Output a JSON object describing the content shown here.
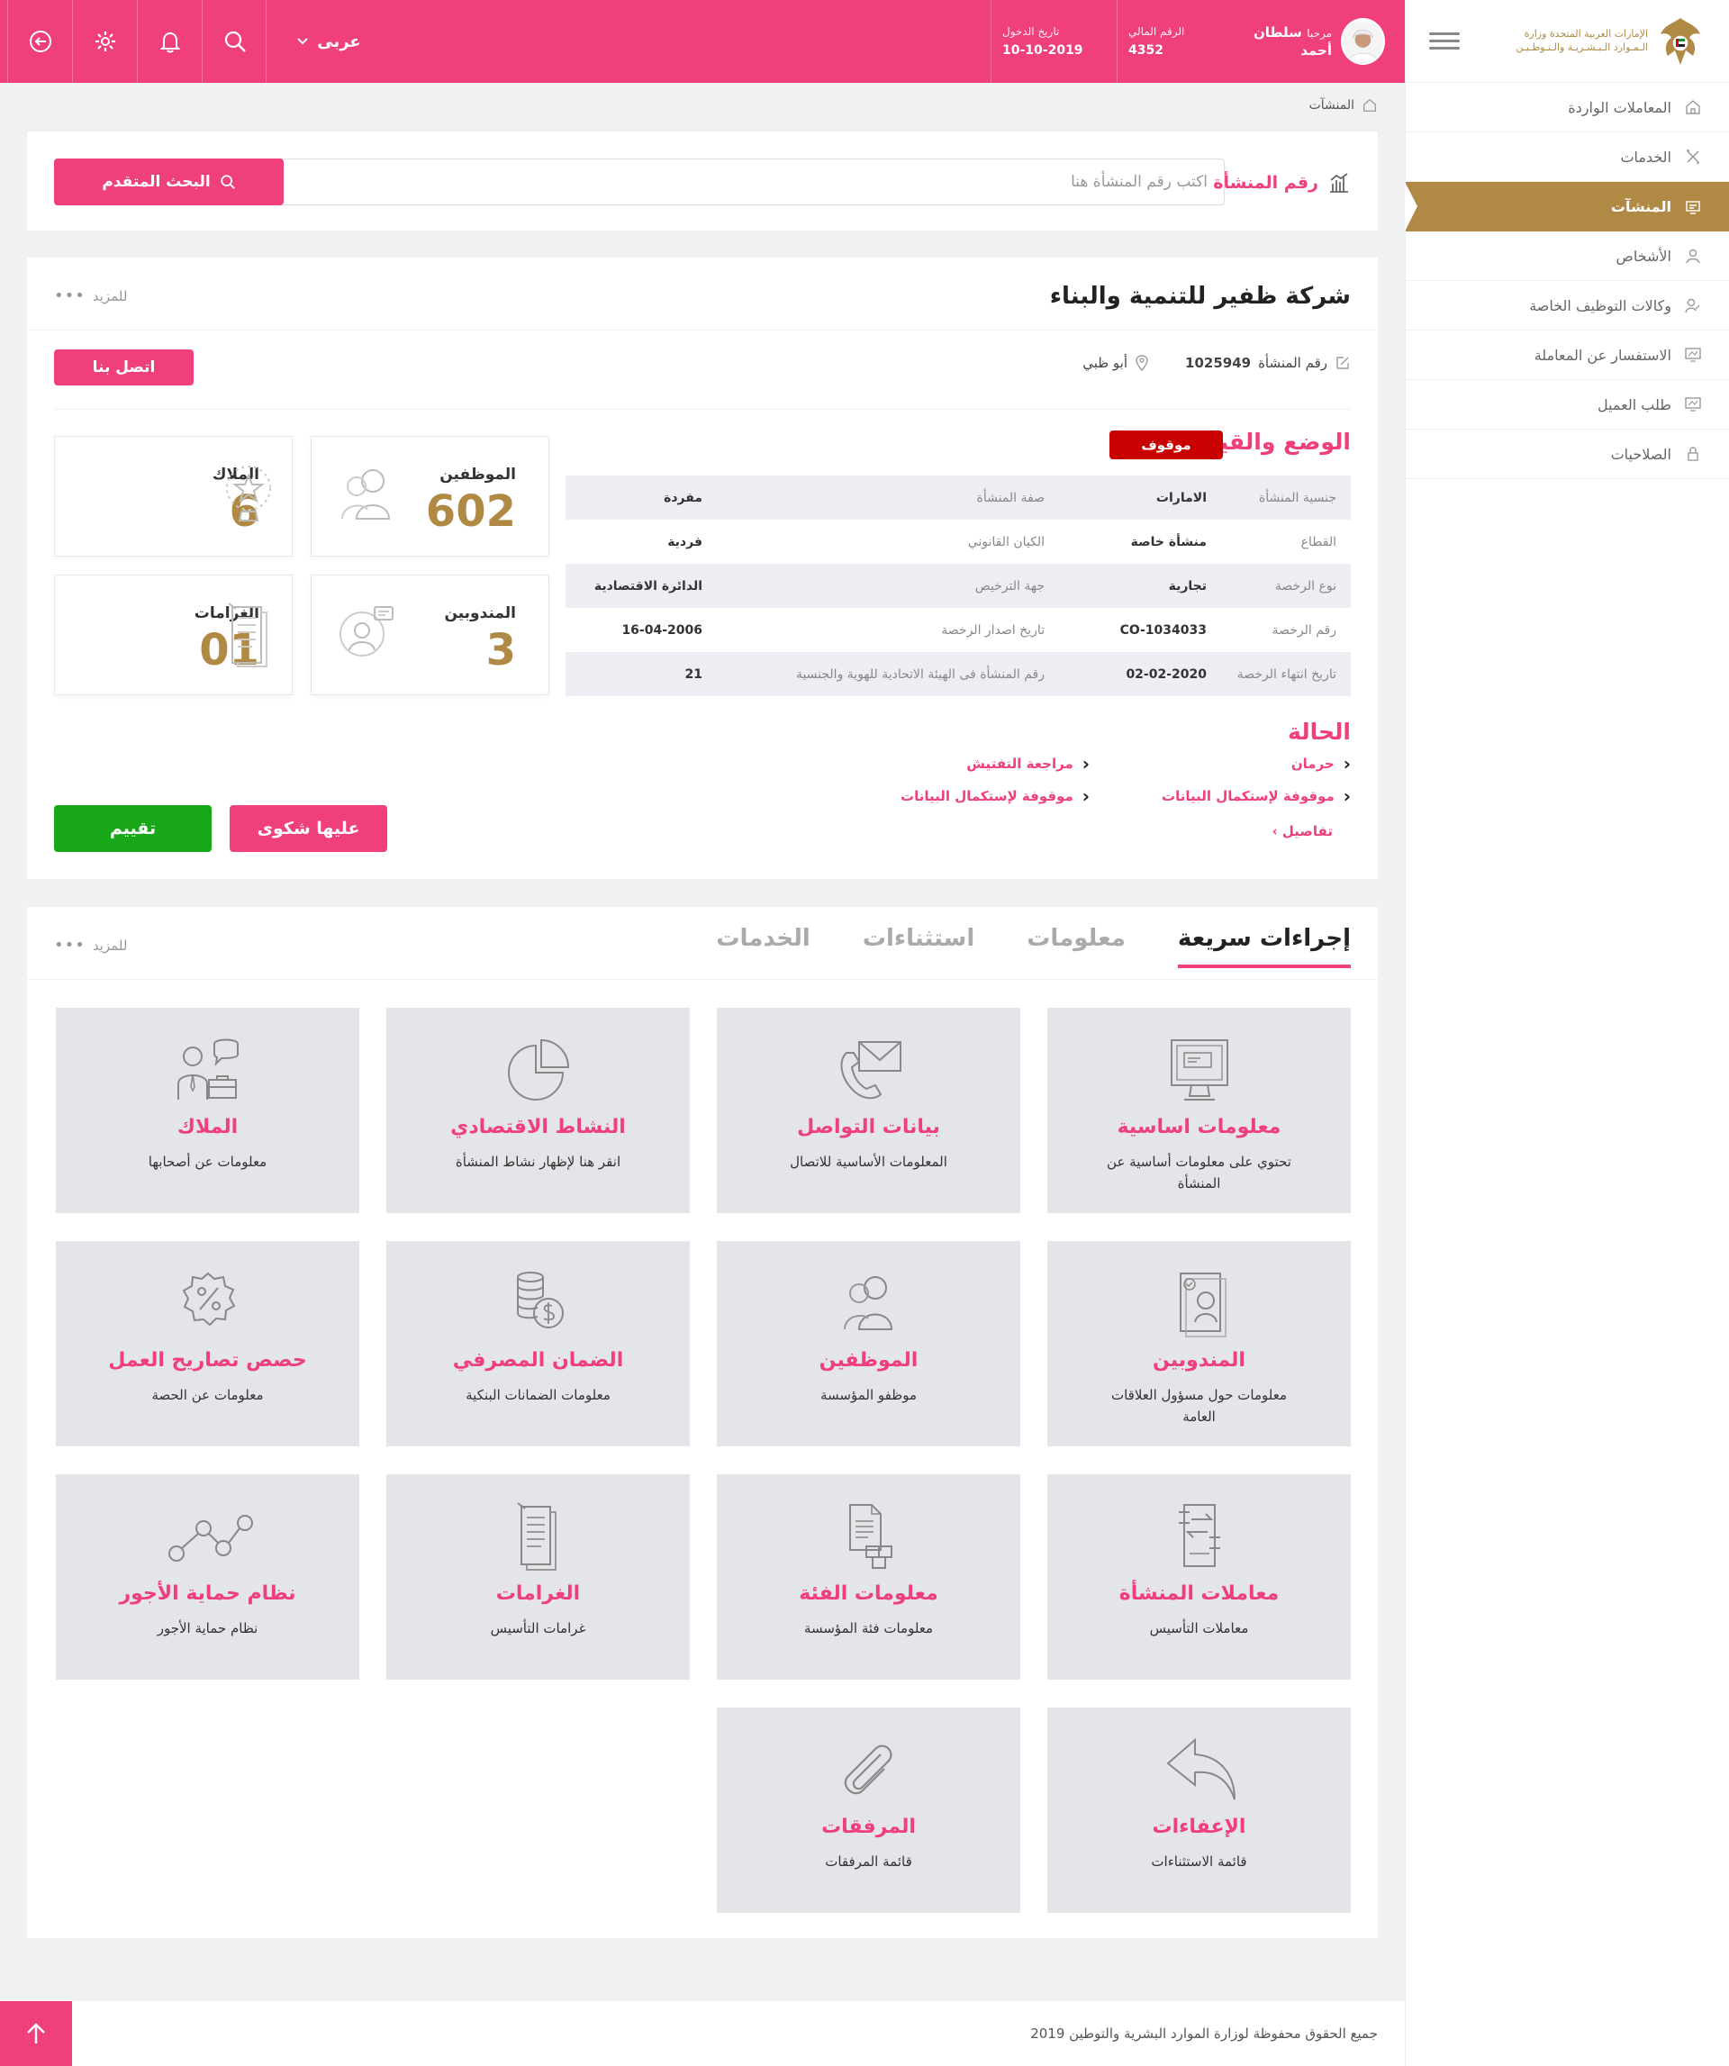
{
  "topbar": {
    "user_greeting": "مرحبا",
    "user_name": "سلطان أحمد",
    "id_label": "الرقم المالي",
    "id_value": "4352",
    "login_label": "تاريخ الدخول",
    "login_value": "10-10-2019",
    "language": "عربى"
  },
  "sidebar": {
    "logo_text": "الإمارات العربية المتحدة وزارة الـمـوارد الـبـشـريـة والـتـوطـيـن",
    "items": [
      {
        "label": "المعاملات الواردة",
        "icon": "home-icon"
      },
      {
        "label": "الخدمات",
        "icon": "tools-icon"
      },
      {
        "label": "المنشآت",
        "icon": "building-icon"
      },
      {
        "label": "الأشخاص",
        "icon": "person-icon"
      },
      {
        "label": "وكالات التوظيف الخاصة",
        "icon": "user-edit-icon"
      },
      {
        "label": "الاستفسار عن المعاملة",
        "icon": "monitor-icon"
      },
      {
        "label": "طلب العميل",
        "icon": "monitor-icon"
      },
      {
        "label": "الصلاحيات",
        "icon": "lock-icon"
      }
    ],
    "active_index": 2
  },
  "breadcrumb": {
    "current": "المنشآت"
  },
  "search": {
    "label": "رقم المنشأة",
    "placeholder": "اكتب رقم المنشأة هنا",
    "advanced_label": "البحث المتقدم"
  },
  "company": {
    "name": "شركة ظفير للتنمية والبناء",
    "more_label": "للمزيد",
    "establishment_label": "رقم المنشأة",
    "establishment_number": "1025949",
    "city": "أبو ظبي",
    "contact_label": "اتصل بنا",
    "stats": [
      {
        "label": "الموظفين",
        "value": "602",
        "icon": "employees-icon"
      },
      {
        "label": "الملاك",
        "value": "6",
        "icon": "star-trophy-icon"
      },
      {
        "label": "المندوبين",
        "value": "3",
        "icon": "support-agent-icon"
      },
      {
        "label": "الغرامات",
        "value": "01",
        "icon": "document-icon"
      }
    ],
    "status_section_title": "الوضع والقيود",
    "status_badge": "موقوف",
    "info_rows": [
      {
        "k1": "جنسية المنشأة",
        "v1": "الامارات",
        "k2": "صفة المنشأة",
        "v2": "مفردة"
      },
      {
        "k1": "القطاع",
        "v1": "منشأة خاصة",
        "k2": "الكيان القانوني",
        "v2": "فردية"
      },
      {
        "k1": "نوع الرخصة",
        "v1": "تجارية",
        "k2": "جهة الترخيص",
        "v2": "الدائرة الاقتصادية"
      },
      {
        "k1": "رقم الرخصة",
        "v1": "CO-1034033",
        "k2": "تاريخ اصدار الرخصة",
        "v2": "16-04-2006"
      },
      {
        "k1": "تاريخ انتهاء الرخصة",
        "v1": "02-02-2020",
        "k2": "رقم المنشأة فى الهيئة الاتحادية للهوية والجنسية",
        "v2": "21"
      }
    ],
    "state_title": "الحالة",
    "states": [
      "حرمان",
      "مراجعة التفتيش",
      "موقوفة لإستكمال البيانات",
      "موقوفة لإستكمال البيانات"
    ],
    "details_label": "تفاصيل",
    "complaint_label": "عليها شكوى",
    "rate_label": "تقييم"
  },
  "tabs": {
    "items": [
      "إجراءات سريعة",
      "معلومات",
      "استثناءات",
      "الخدمات"
    ],
    "active_index": 0,
    "more_label": "للمزيد"
  },
  "tiles": [
    {
      "title": "معلومات اساسية",
      "desc": "تحتوي على معلومات أساسية عن المنشأة",
      "icon": "monitor-info-icon"
    },
    {
      "title": "بيانات التواصل",
      "desc": "المعلومات الأساسية للاتصال",
      "icon": "phone-mail-icon"
    },
    {
      "title": "النشاط الاقتصادي",
      "desc": "انقر هنا لإظهار نشاط المنشأة",
      "icon": "pie-chart-icon"
    },
    {
      "title": "الملاك",
      "desc": "معلومات عن أصحابها",
      "icon": "owners-icon"
    },
    {
      "title": "المندوبين",
      "desc": "معلومات حول مسؤول العلاقات العامة",
      "icon": "profile-doc-icon"
    },
    {
      "title": "الموظفين",
      "desc": "موظفو المؤسسة",
      "icon": "employees-icon"
    },
    {
      "title": "الضمان المصرفي",
      "desc": "معلومات الضمانات البنكية",
      "icon": "coins-icon"
    },
    {
      "title": "حصص تصاريح العمل",
      "desc": "معلومات عن الحصة",
      "icon": "percent-badge-icon"
    },
    {
      "title": "معاملات المنشأة",
      "desc": "معاملات التأسيس",
      "icon": "transfer-doc-icon"
    },
    {
      "title": "معلومات الفئة",
      "desc": "معلومات فئة المؤسسة",
      "icon": "doc-boxes-icon"
    },
    {
      "title": "الغرامات",
      "desc": "غرامات التأسيس",
      "icon": "document-icon"
    },
    {
      "title": "نظام حماية الأجور",
      "desc": "نظام حماية الأجور",
      "icon": "line-chart-icon"
    },
    {
      "title": "الإعفاءات",
      "desc": "قائمة الاستثناءات",
      "icon": "reply-arrow-icon"
    },
    {
      "title": "المرفقات",
      "desc": "قائمة المرفقات",
      "icon": "paperclip-icon"
    }
  ],
  "footer": {
    "copyright": "جميع الحقوق محفوظة لوزارة الموارد البشرية والتوطين 2019"
  }
}
